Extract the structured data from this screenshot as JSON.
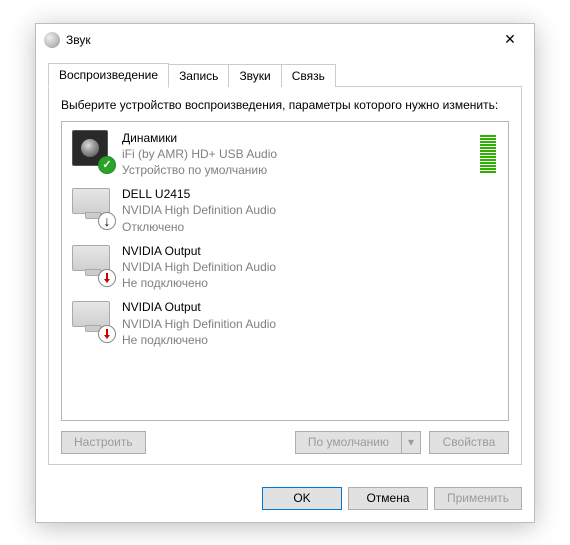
{
  "window": {
    "title": "Звук",
    "close_symbol": "✕"
  },
  "tabs": [
    {
      "label": "Воспроизведение",
      "active": true
    },
    {
      "label": "Запись",
      "active": false
    },
    {
      "label": "Звуки",
      "active": false
    },
    {
      "label": "Связь",
      "active": false
    }
  ],
  "instruction": "Выберите устройство воспроизведения, параметры которого нужно изменить:",
  "devices": [
    {
      "name": "Динамики",
      "driver": "iFi (by AMR) HD+ USB Audio",
      "status": "Устройство по умолчанию",
      "icon": "speaker",
      "badge": "default",
      "level": 13
    },
    {
      "name": "DELL U2415",
      "driver": "NVIDIA High Definition Audio",
      "status": "Отключено",
      "icon": "monitor",
      "badge": "disabled",
      "level": 0
    },
    {
      "name": "NVIDIA Output",
      "driver": "NVIDIA High Definition Audio",
      "status": "Не подключено",
      "icon": "monitor",
      "badge": "unplugged",
      "level": 0
    },
    {
      "name": "NVIDIA Output",
      "driver": "NVIDIA High Definition Audio",
      "status": "Не подключено",
      "icon": "monitor",
      "badge": "unplugged",
      "level": 0
    }
  ],
  "buttons": {
    "configure": "Настроить",
    "set_default": "По умолчанию",
    "properties": "Свойства",
    "ok": "OK",
    "cancel": "Отмена",
    "apply": "Применить",
    "dropdown_symbol": "▾"
  }
}
